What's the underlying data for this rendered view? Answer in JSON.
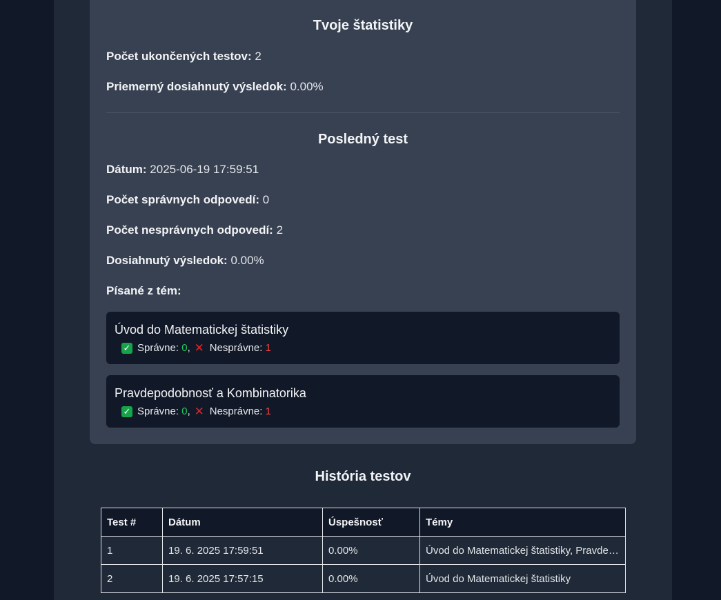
{
  "stats": {
    "title": "Tvoje štatistiky",
    "completed_label": "Počet ukončených testov:",
    "completed_value": "2",
    "average_label": "Priemerný dosiahnutý výsledok:",
    "average_value": "0.00%"
  },
  "last_test": {
    "title": "Posledný test",
    "date_label": "Dátum:",
    "date_value": "2025-06-19 17:59:51",
    "correct_label": "Počet správnych odpovedí:",
    "correct_value": "0",
    "wrong_label": "Počet nesprávnych odpovedí:",
    "wrong_value": "2",
    "result_label": "Dosiahnutý výsledok:",
    "result_value": "0.00%",
    "topics_label": "Písané z tém:",
    "topics": [
      {
        "name": "Úvod do Matematickej štatistiky",
        "correct_label": "Správne:",
        "correct": "0",
        "wrong_label": "Nesprávne:",
        "wrong": "1"
      },
      {
        "name": "Pravdepodobnosť a Kombinatorika",
        "correct_label": "Správne:",
        "correct": "0",
        "wrong_label": "Nesprávne:",
        "wrong": "1"
      }
    ]
  },
  "history": {
    "title": "História testov",
    "columns": [
      "Test #",
      "Dátum",
      "Úspešnosť",
      "Témy"
    ],
    "rows": [
      [
        "1",
        "19. 6. 2025 17:59:51",
        "0.00%",
        "Úvod do Matematickej štatistiky, Pravdepodobnosť a Kombinatorika"
      ],
      [
        "2",
        "19. 6. 2025 17:57:15",
        "0.00%",
        "Úvod do Matematickej štatistiky"
      ]
    ]
  },
  "icons": {
    "correct": "check-mark-icon",
    "wrong": "cross-mark-icon"
  },
  "colors": {
    "correct": "#22c55e",
    "wrong": "#ef4444",
    "card": "#374151",
    "page": "#1f2937"
  }
}
